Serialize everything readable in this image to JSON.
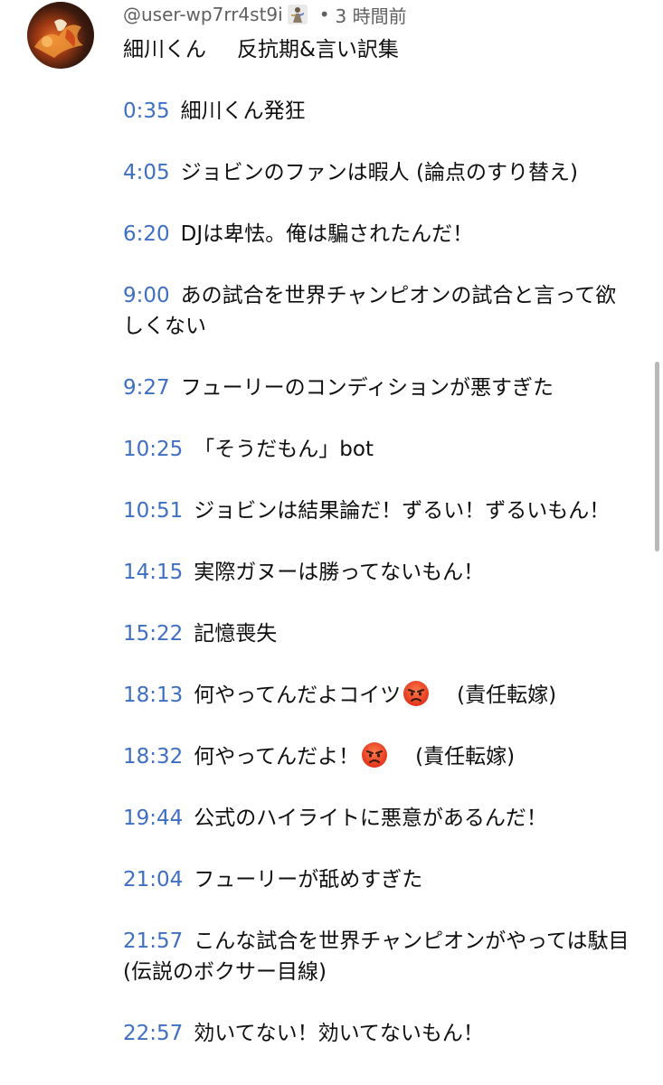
{
  "comment": {
    "handle": "@user-wp7rr4st9i",
    "separator": "•",
    "time_ago": "3 時間前",
    "title_left": "細川くん",
    "title_right": "反抗期&言い訳集",
    "entries": [
      {
        "time": "0:35",
        "text": "細川くん発狂"
      },
      {
        "time": "4:05",
        "text": "ジョビンのファンは暇人 (論点のすり替え)"
      },
      {
        "time": "6:20",
        "text": "DJは卑怯。俺は騙されたんだ！"
      },
      {
        "time": "9:00",
        "text": "あの試合を世界チャンピオンの試合と言って欲しくない"
      },
      {
        "time": "9:27",
        "text": "フューリーのコンディションが悪すぎた"
      },
      {
        "time": "10:25",
        "text": "「そうだもん」bot"
      },
      {
        "time": "10:51",
        "text": "ジョビンは結果論だ！ずるい！ずるいもん！"
      },
      {
        "time": "14:15",
        "text": "実際ガヌーは勝ってないもん！"
      },
      {
        "time": "15:22",
        "text": "記憶喪失"
      },
      {
        "time": "18:13",
        "text": "何やってんだよコイツ",
        "emoji": "angry-face",
        "suffix": "(責任転嫁)"
      },
      {
        "time": "18:32",
        "text": "何やってんだよ！",
        "emoji": "angry-face",
        "suffix": "(責任転嫁)"
      },
      {
        "time": "19:44",
        "text": "公式のハイライトに悪意があるんだ！"
      },
      {
        "time": "21:04",
        "text": "フューリーが舐めすぎた"
      },
      {
        "time": "21:57",
        "text": "こんな試合を世界チャンピオンがやっては駄目 (伝説のボクサー目線)"
      },
      {
        "time": "22:57",
        "text": "効いてない！効いてないもん！"
      }
    ]
  },
  "colors": {
    "timestamp": "#3e6fc2",
    "meta_text": "#606060",
    "body_text": "#0f0f0f"
  },
  "icons": {
    "avatar": "avatar-image",
    "badge": "member-badge-icon",
    "emoji": "angry-face"
  }
}
